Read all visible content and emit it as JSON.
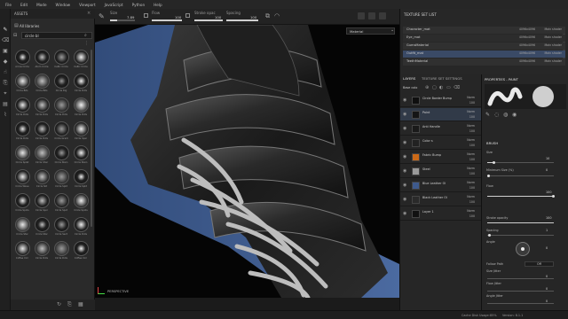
{
  "menu": [
    "File",
    "Edit",
    "Mode",
    "Window",
    "Viewport",
    "JavaScript",
    "Python",
    "Help"
  ],
  "toolbar": {
    "size_label": "Size",
    "size_value": "7.89",
    "flow_label": "Flow",
    "flow_value": "100",
    "stroke_label": "Stroke opac",
    "stroke_value": "100",
    "spacing_label": "Spacing",
    "spacing_value": "100"
  },
  "assets": {
    "title": "ASSETS",
    "library": "All libraries",
    "search_value": "circle bl",
    "items": [
      {
        "name": "Arrow Circle"
      },
      {
        "name": "Atom Circle"
      },
      {
        "name": "Celtic Circle"
      },
      {
        "name": "Celtic Circle"
      },
      {
        "name": "Circle Bits"
      },
      {
        "name": "Circle Bits"
      },
      {
        "name": "Circle Dig"
      },
      {
        "name": "Circle Dots"
      },
      {
        "name": "Circle Dots"
      },
      {
        "name": "Circle Dots"
      },
      {
        "name": "Circle Dots"
      },
      {
        "name": "Circle Dots"
      },
      {
        "name": "Circle Dots"
      },
      {
        "name": "Circle Dots"
      },
      {
        "name": "Circle Gradi"
      },
      {
        "name": "Circle Spar"
      },
      {
        "name": "Circle Splat"
      },
      {
        "name": "Circle Shar"
      },
      {
        "name": "Circle Stain"
      },
      {
        "name": "Circle Stain"
      },
      {
        "name": "Circle Wave"
      },
      {
        "name": "Circle Slit"
      },
      {
        "name": "Circle Split"
      },
      {
        "name": "Circle Split"
      },
      {
        "name": "Circle Spots"
      },
      {
        "name": "Circle Spor"
      },
      {
        "name": "Circle Spot"
      },
      {
        "name": "Circle Spots"
      },
      {
        "name": "Circle Star"
      },
      {
        "name": "Circle Star"
      },
      {
        "name": "Circle Sect"
      },
      {
        "name": "Circle Dots"
      },
      {
        "name": "Coffee Circ"
      },
      {
        "name": "Circle Dots"
      },
      {
        "name": "Circle Dots"
      },
      {
        "name": "Coffee Circ"
      }
    ]
  },
  "viewport": {
    "material_dropdown": "Material",
    "camera_label": "PERSPECTIVE"
  },
  "texture_set_list": {
    "title": "TEXTURE SET LIST",
    "rows": [
      {
        "name": "Character_mat",
        "res": "4096x4096",
        "shader": "Main shader"
      },
      {
        "name": "Eye_mat",
        "res": "4096x4096",
        "shader": "Main shader"
      },
      {
        "name": "GumsMaterial",
        "res": "4096x4096",
        "shader": "Main shader"
      },
      {
        "name": "Outfit_mat",
        "res": "4096x4096",
        "shader": "Main shader"
      },
      {
        "name": "TeethMaterial",
        "res": "4096x4096",
        "shader": "Main shader"
      }
    ]
  },
  "layers": {
    "tab_layers": "LAYERS",
    "tab_tss": "TEXTURE SET SETTINGS",
    "blend_mode": "Base colo",
    "items": [
      {
        "name": "Circle Border Bump",
        "blend": "Norm",
        "opacity": "100"
      },
      {
        "name": "Paint",
        "blend": "Norm",
        "opacity": "100"
      },
      {
        "name": "Anti Handle",
        "blend": "Norm",
        "opacity": "100"
      },
      {
        "name": "Color s",
        "blend": "Norm",
        "opacity": "100"
      },
      {
        "name": "Fabric Bump",
        "blend": "Norm",
        "opacity": "100"
      },
      {
        "name": "Steel",
        "blend": "Norm",
        "opacity": "100"
      },
      {
        "name": "Blue Leather Ol",
        "blend": "Norm",
        "opacity": "100"
      },
      {
        "name": "Black Leather Ol",
        "blend": "Norm",
        "opacity": "100"
      },
      {
        "name": "Layer 1",
        "blend": "Norm",
        "opacity": "100"
      }
    ]
  },
  "properties": {
    "title": "PROPERTIES - PAINT",
    "section": "BRUSH",
    "size_label": "Size",
    "size_value": "10",
    "min_size_label": "Minimum Size (%)",
    "min_size_value": "0",
    "flow_label": "Flow",
    "flow_value": "100",
    "stroke_opacity_label": "Stroke opacity",
    "stroke_opacity_value": "100",
    "spacing_label": "Spacing",
    "spacing_value": "1",
    "angle_label": "Angle",
    "angle_value": "0",
    "follow_path_label": "Follow Path",
    "follow_path_value": "Off",
    "size_jitter_label": "Size Jitter",
    "size_jitter_value": "0",
    "flow_jitter_label": "Flow Jitter",
    "flow_jitter_value": "0",
    "angle_jitter_label": "Angle Jitter",
    "angle_jitter_value": "0"
  },
  "status": {
    "cache": "Cache Disk Usage:",
    "cache_value": "85%",
    "version": "Version: 8.1.1"
  },
  "colors": {
    "accent": "#3d6fb0",
    "leather": "#2b2b2b",
    "fabric": "#3e5a8c",
    "strap": "#bdbdbd"
  }
}
